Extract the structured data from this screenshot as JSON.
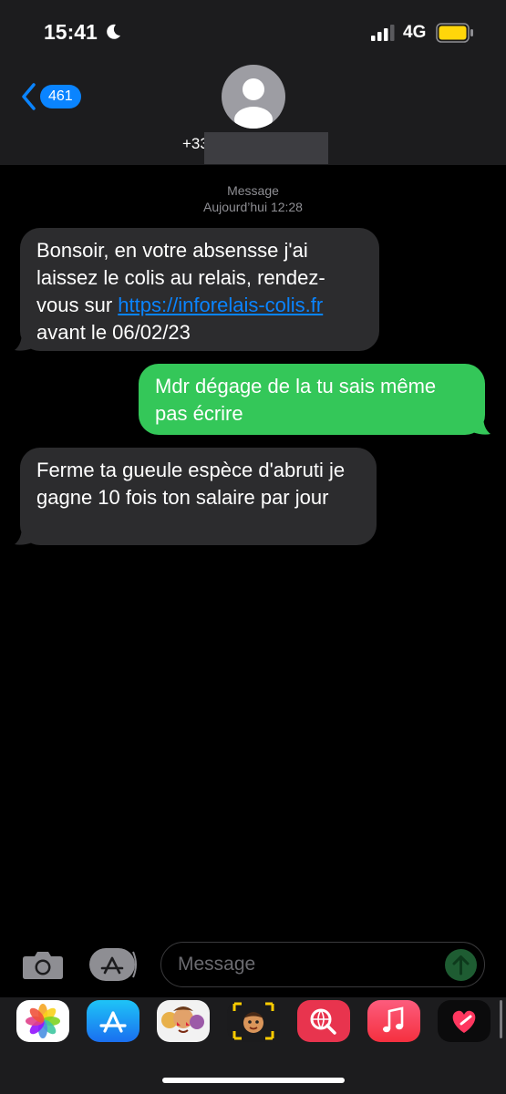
{
  "status_bar": {
    "time": "15:41",
    "network": "4G",
    "battery_color": "#ffd60a"
  },
  "header": {
    "back_count": "461",
    "contact_prefix": "+33"
  },
  "thread": {
    "sender_label": "Message",
    "date_label": "Aujourd’hui 12:28",
    "messages": [
      {
        "direction": "incoming",
        "text_before_link": "Bonsoir, en votre absensse j'ai laissez le colis au relais, rendez-vous sur ",
        "link": "https://inforelais-colis.fr",
        "text_after_link": " avant le 06/02/23"
      },
      {
        "direction": "outgoing",
        "text": "Mdr dégage de la tu sais même pas écrire"
      },
      {
        "direction": "incoming",
        "text": "Ferme ta gueule espèce d'abruti je gagne 10 fois ton salaire par jour"
      }
    ]
  },
  "composer": {
    "placeholder": "Message"
  },
  "app_drawer": {
    "apps": [
      "photos-icon",
      "app-store-icon",
      "memoji-stickers-icon",
      "memoji-icon",
      "web-search-icon",
      "music-icon",
      "digital-touch-icon"
    ]
  },
  "colors": {
    "incoming_bubble": "#2c2c2e",
    "outgoing_bubble": "#34c759",
    "accent": "#0a84ff"
  }
}
